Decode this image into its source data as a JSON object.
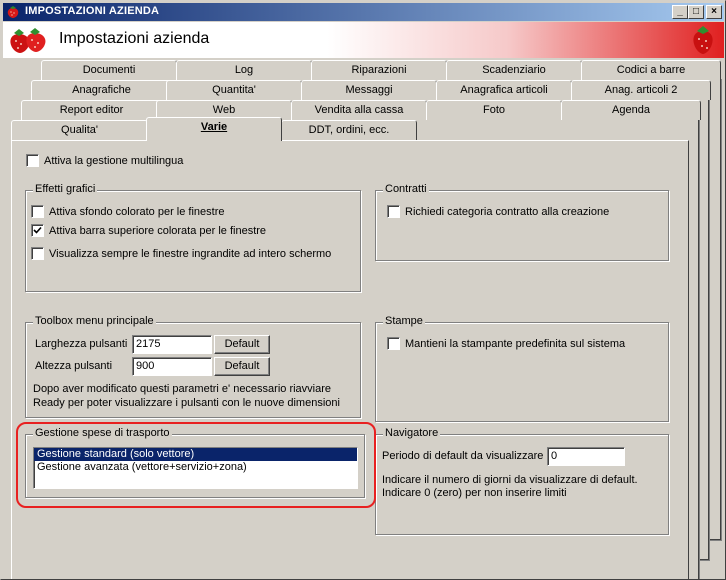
{
  "window": {
    "title": "IMPOSTAZIONI AZIENDA",
    "header_title": "Impostazioni azienda",
    "controls": {
      "minimize": "_",
      "maximize": "□",
      "close": "×"
    }
  },
  "tabs": {
    "row1": [
      "Documenti",
      "Log",
      "Riparazioni",
      "Scadenziario",
      "Codici a barre"
    ],
    "row2": [
      "Anagrafiche",
      "Quantita'",
      "Messaggi",
      "Anagrafica articoli",
      "Anag. articoli 2"
    ],
    "row3": [
      "Report editor",
      "Web",
      "Vendita alla cassa",
      "Foto",
      "Agenda"
    ],
    "row4": [
      "Qualita'",
      "Varie",
      "DDT, ordini, ecc."
    ],
    "active": "Varie"
  },
  "multilingua": {
    "label": "Attiva la gestione multilingua",
    "checked": false
  },
  "effetti_grafici": {
    "title": "Effetti grafici",
    "options": [
      {
        "label": "Attiva sfondo colorato per le finestre",
        "checked": false
      },
      {
        "label": "Attiva barra superiore colorata per le finestre",
        "checked": true
      },
      {
        "label": "Visualizza sempre le finestre ingrandite ad intero schermo",
        "checked": false
      }
    ]
  },
  "contratti": {
    "title": "Contratti",
    "option": {
      "label": "Richiedi categoria contratto alla creazione",
      "checked": false
    }
  },
  "toolbox": {
    "title": "Toolbox menu principale",
    "width_label": "Larghezza pulsanti",
    "width_value": "2175",
    "height_label": "Altezza pulsanti",
    "height_value": "900",
    "default_label": "Default",
    "note_line1": "Dopo aver modificato questi parametri e' necessario riavviare",
    "note_line2": "Ready per poter visualizzare i pulsanti con le nuove dimensioni"
  },
  "stampe": {
    "title": "Stampe",
    "option": {
      "label": "Mantieni la stampante predefinita sul sistema",
      "checked": false
    }
  },
  "spese_trasporto": {
    "title": "Gestione spese di trasporto",
    "items": [
      "Gestione standard (solo vettore)",
      "Gestione avanzata (vettore+servizio+zona)"
    ],
    "selected_index": 0
  },
  "navigatore": {
    "title": "Navigatore",
    "period_label": "Periodo di default da visualizzare",
    "period_value": "0",
    "note_line1": "Indicare il numero di giorni da visualizzare di default.",
    "note_line2": "Indicare 0 (zero) per non inserire limiti"
  },
  "colors": {
    "titlebar_start": "#0a246a",
    "titlebar_end": "#a6caf0",
    "highlight": "#e82020",
    "selection": "#0a246a"
  }
}
